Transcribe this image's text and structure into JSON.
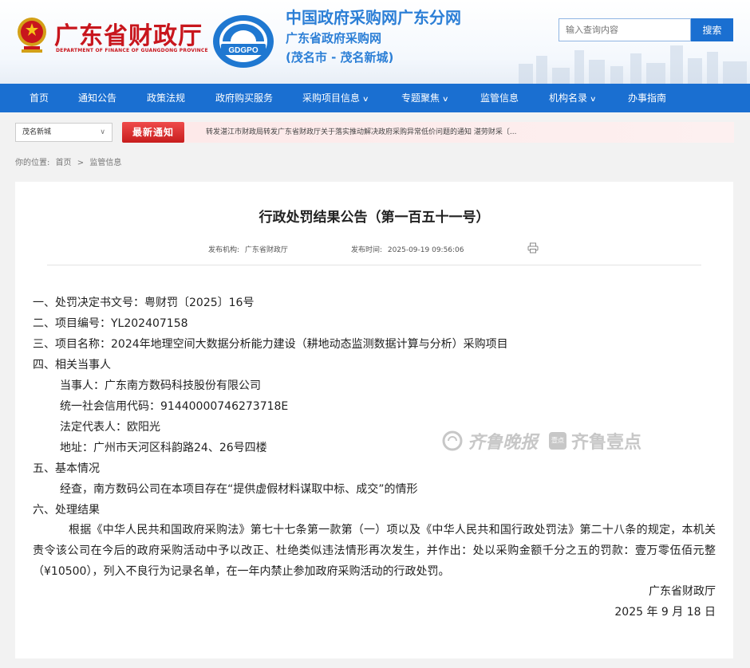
{
  "header": {
    "dept_cn": "广东省财政厅",
    "dept_en": "DEPARTMENT OF FINANCE OF GUANGDONG PROVINCE",
    "logo_text": "GDGPO",
    "site_title": "中国政府采购网广东分网",
    "site_sub": "广东省政府采购网",
    "site_city": "(茂名市 - 茂名新城)",
    "search_placeholder": "输入查询内容",
    "search_button": "搜索"
  },
  "nav": [
    {
      "label": "首页"
    },
    {
      "label": "通知公告"
    },
    {
      "label": "政策法规"
    },
    {
      "label": "政府购买服务"
    },
    {
      "label": "采购项目信息",
      "chevron": true
    },
    {
      "label": "专题聚焦",
      "chevron": true
    },
    {
      "label": "监管信息"
    },
    {
      "label": "机构名录",
      "chevron": true
    },
    {
      "label": "办事指南"
    }
  ],
  "region_select": "茂名新城",
  "news": {
    "badge": "最新通知",
    "text": "转发湛江市财政局转发广东省财政厅关于落实推动解决政府采购异常低价问题的通知 湛劳财采〔..."
  },
  "breadcrumb": {
    "label": "你的位置:",
    "home": "首页",
    "sep": ">",
    "current": "监管信息"
  },
  "article": {
    "title": "行政处罚结果公告（第一百五十一号）",
    "publisher_label": "发布机构:",
    "publisher": "广东省财政厅",
    "time_label": "发布时间:",
    "time": "2025-09-19 09:56:06",
    "lines": [
      "一、处罚决定书文号：粤财罚〔2025〕16号",
      "二、项目编号：YL202407158",
      "三、项目名称：2024年地理空间大数据分析能力建设（耕地动态监测数据计算与分析）采购项目",
      "四、相关当事人",
      "当事人：广东南方数码科技股份有限公司",
      "统一社会信用代码：91440000746273718E",
      "法定代表人：欧阳光",
      "地址：广州市天河区科韵路24、26号四楼",
      "五、基本情况",
      "经查，南方数码公司在本项目存在“提供虚假材料谋取中标、成交”的情形",
      "六、处理结果"
    ],
    "paragraph": "根据《中华人民共和国政府采购法》第七十七条第一款第（一）项以及《中华人民共和国行政处罚法》第二十八条的规定，本机关责令该公司在今后的政府采购活动中予以改正、杜绝类似违法情形再次发生，并作出：处以采购金额千分之五的罚款：壹万零伍佰元整（¥10500），列入不良行为记录名单，在一年内禁止参加政府采购活动的行政处罚。",
    "sign_org": "广东省财政厅",
    "sign_date": "2025 年 9 月 18 日"
  },
  "watermark": {
    "brand1": "齐鲁晚报",
    "brand2": "齐鲁壹点",
    "badge": "壹点"
  }
}
